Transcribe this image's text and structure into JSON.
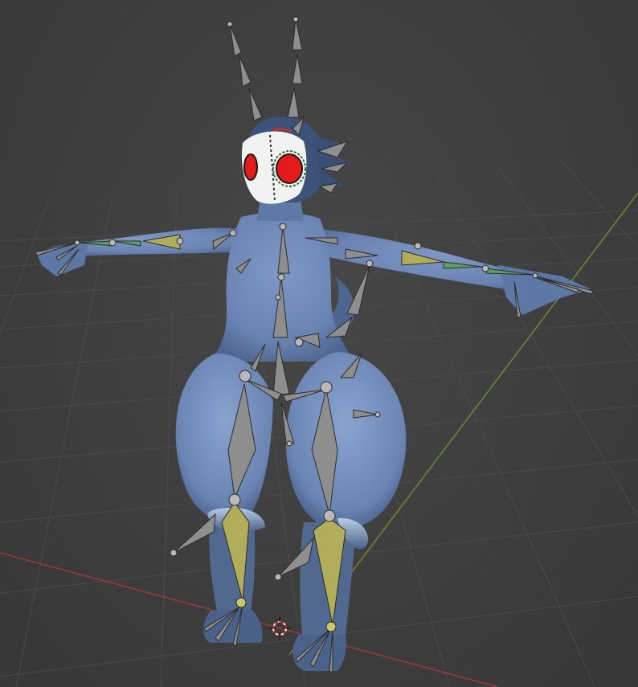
{
  "viewport": {
    "view": "perspective",
    "mode": "pose",
    "grid_visible": true,
    "axes_visible": [
      "x",
      "y"
    ],
    "colors": {
      "background": "#3d3d3d",
      "grid_line": "#4a4a4a",
      "x_axis": "#9c3a3a",
      "y_axis": "#6e8a2f",
      "mesh_skin": "#6d86b4",
      "mask": "#f2f2f2",
      "eye": "#e31b1b",
      "bone": "#8e8e8e",
      "bone_selected_active": "#b0ae5a",
      "bone_selected": "#5ea062"
    }
  },
  "scene": {
    "object": "character-mesh",
    "armature": "armature",
    "cursor": "3d-cursor-icon"
  }
}
